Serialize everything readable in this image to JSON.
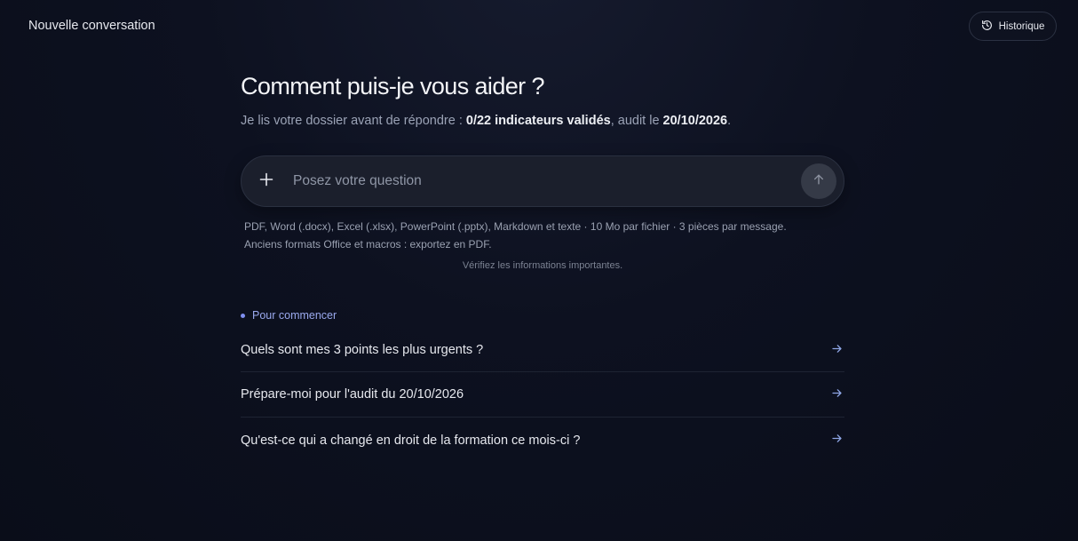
{
  "header": {
    "title": "Nouvelle conversation",
    "history_label": "Historique"
  },
  "main": {
    "heading": "Comment puis-je vous aider ?",
    "subtitle": {
      "prefix": "Je lis votre dossier avant de répondre : ",
      "indicators": "0/22 indicateurs validés",
      "middle": ", audit le ",
      "date": "20/10/2026",
      "suffix": "."
    },
    "composer": {
      "placeholder": "Posez votre question",
      "value": ""
    },
    "file_info_line1": "PDF, Word (.docx), Excel (.xlsx), PowerPoint (.pptx), Markdown et texte · 10 Mo par fichier · 3 pièces par message.",
    "file_info_line2": "Anciens formats Office et macros : exportez en PDF.",
    "disclaimer": "Vérifiez les informations importantes."
  },
  "suggestions": {
    "label": "Pour commencer",
    "items": [
      {
        "text": "Quels sont mes 3 points les plus urgents ?"
      },
      {
        "text": "Prépare-moi pour l'audit du 20/10/2026"
      },
      {
        "text": "Qu'est-ce qui a changé en droit de la formation ce mois-ci ?"
      }
    ]
  },
  "icons": {
    "history": "history-icon",
    "plus": "plus-icon",
    "send": "arrow-up-icon",
    "suggestion_arrow": "arrow-right-icon"
  },
  "colors": {
    "background": "#0b0e1a",
    "accent": "#8a98f0",
    "arrow": "#8fa6e6"
  }
}
